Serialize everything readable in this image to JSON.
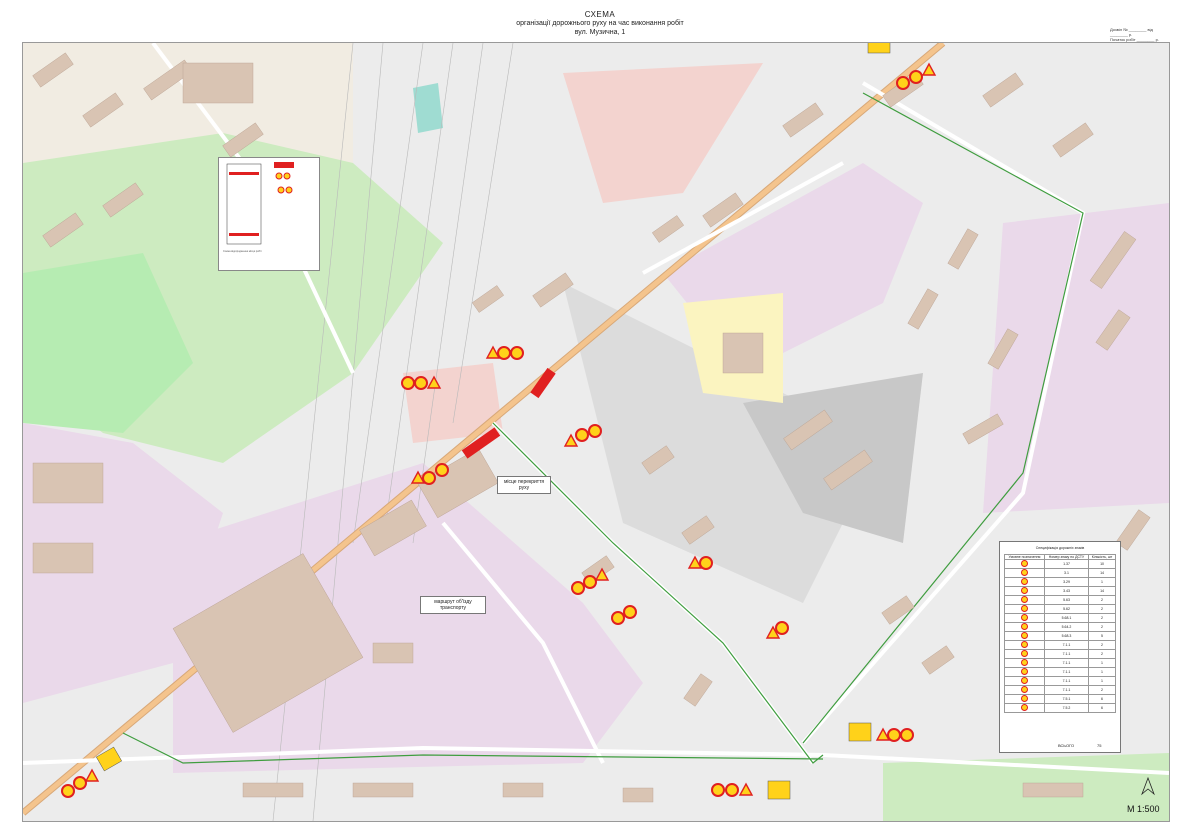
{
  "title": {
    "line1": "СХЕМА",
    "line2": "організації дорожнього руху на час виконання робіт",
    "line3": "вул. Музична, 1"
  },
  "stamp": {
    "line1": "Дозвіл № ________ від ________ р.",
    "line2": "Початок робіт ________ р.",
    "line3": "Закінчення робіт ________ р."
  },
  "labels": {
    "closure": "місце перекриття руху",
    "detour": "маршрут об'їзду транспорту"
  },
  "scale": "М 1:500",
  "spec_table": {
    "caption": "Специфікація дорожніх знаків",
    "headers": [
      "Умовне позначення",
      "Номер знаку по ДСТУ",
      "Кількість, шт"
    ],
    "rows": [
      {
        "sign": "triangle",
        "code": "1.37",
        "qty": "10"
      },
      {
        "sign": "circle-red",
        "code": "3.1",
        "qty": "14"
      },
      {
        "sign": "circle-30",
        "code": "3.29",
        "qty": "1"
      },
      {
        "sign": "circle-bars",
        "code": "3.43",
        "qty": "14"
      },
      {
        "sign": "detour-yellow",
        "code": "5.63",
        "qty": "2"
      },
      {
        "sign": "detour-yellow2",
        "code": "5.62",
        "qty": "2"
      },
      {
        "sign": "plate",
        "code": "5.68.1",
        "qty": "2"
      },
      {
        "sign": "plate",
        "code": "5.64.2",
        "qty": "2"
      },
      {
        "sign": "plate",
        "code": "5.68.3",
        "qty": "5"
      },
      {
        "sign": "plate-20m",
        "code": "7.1.1",
        "qty": "2"
      },
      {
        "sign": "plate-50m",
        "code": "7.1.1",
        "qty": "2"
      },
      {
        "sign": "plate-150m",
        "code": "7.1.1",
        "qty": "1"
      },
      {
        "sign": "plate-200m",
        "code": "7.1.1",
        "qty": "1"
      },
      {
        "sign": "plate-450m",
        "code": "7.1.1",
        "qty": "1"
      },
      {
        "sign": "plate-500m",
        "code": "7.1.1",
        "qty": "2"
      },
      {
        "sign": "plate-line",
        "code": "7.5.1",
        "qty": "6"
      },
      {
        "sign": "plate-line2",
        "code": "7.5.2",
        "qty": "6"
      }
    ],
    "total_label": "ВСЬОГО",
    "total_value": "75"
  },
  "legend_inset": {
    "caption": "Схема відгородження місця робіт"
  },
  "colors": {
    "residential": "#ead9ea",
    "industrial": "#dcdcdc",
    "park": "#cdebc0",
    "railway_zone": "#f3d3cf",
    "road": "#ffffff",
    "main_road": "#f4c48d",
    "building": "#d9c4b3",
    "detour_route": "#3f9d3f",
    "sign_red": "#e02020",
    "sign_yellow": "#ffd21a"
  }
}
